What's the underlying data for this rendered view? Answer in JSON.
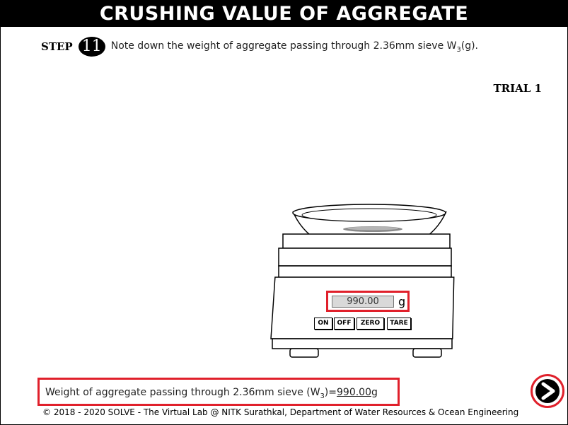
{
  "header": {
    "title": "CRUSHING VALUE OF AGGREGATE"
  },
  "step": {
    "label": "STEP",
    "number": "11",
    "instruction_main": "Note down the weight of aggregate passing through 2.36mm sieve W",
    "instruction_sub": "3",
    "instruction_end": "(g)."
  },
  "trial": {
    "label": "TRIAL 1"
  },
  "scale": {
    "reading": "990.00",
    "unit": "g",
    "buttons": {
      "on": "ON",
      "off": "OFF",
      "zero": "ZERO",
      "tare": "TARE"
    }
  },
  "result": {
    "label": "Weight of aggregate passing through 2.36mm sieve (W",
    "sub": "3",
    "equals": ")=",
    "value": "990.00",
    "unit": "g"
  },
  "footer": {
    "text": "© 2018 - 2020 SOLVE - The Virtual Lab @ NITK Surathkal, Department of Water Resources & Ocean Engineering"
  },
  "colors": {
    "highlight": "#e0202b",
    "title_bg": "#000000"
  },
  "icons": {
    "next": "chevron-right-icon"
  }
}
